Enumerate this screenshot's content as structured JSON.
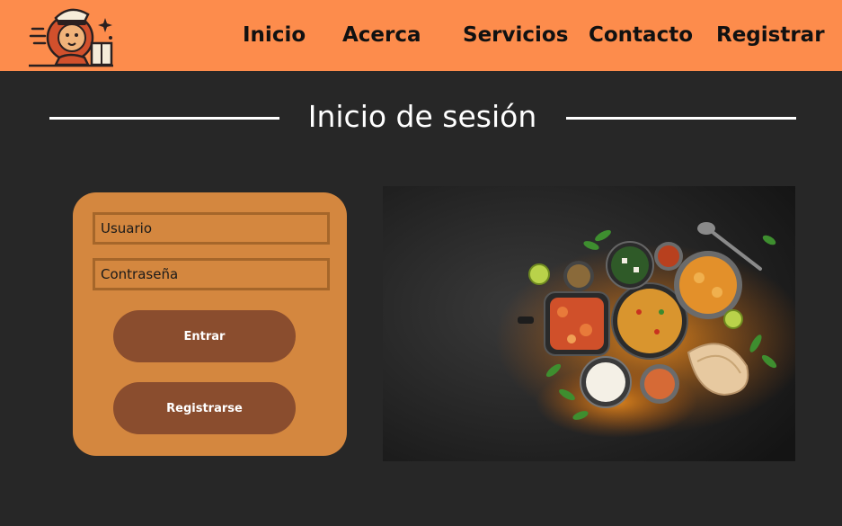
{
  "nav": {
    "links": [
      "Inicio",
      "Acerca",
      "Servicios",
      "Contacto",
      "Registrar"
    ]
  },
  "page": {
    "title": "Inicio de sesión"
  },
  "login": {
    "username_placeholder": "Usuario",
    "password_placeholder": "Contraseña",
    "submit_label": "Entrar",
    "register_label": "Registrarse"
  },
  "colors": {
    "navbar": "#fd8c4c",
    "background": "#272727",
    "card": "#d4873f",
    "button": "#8a4d2e"
  },
  "icons": {
    "logo": "lion-chef-delivery-logo",
    "hero": "indian-food-spread-photo"
  }
}
